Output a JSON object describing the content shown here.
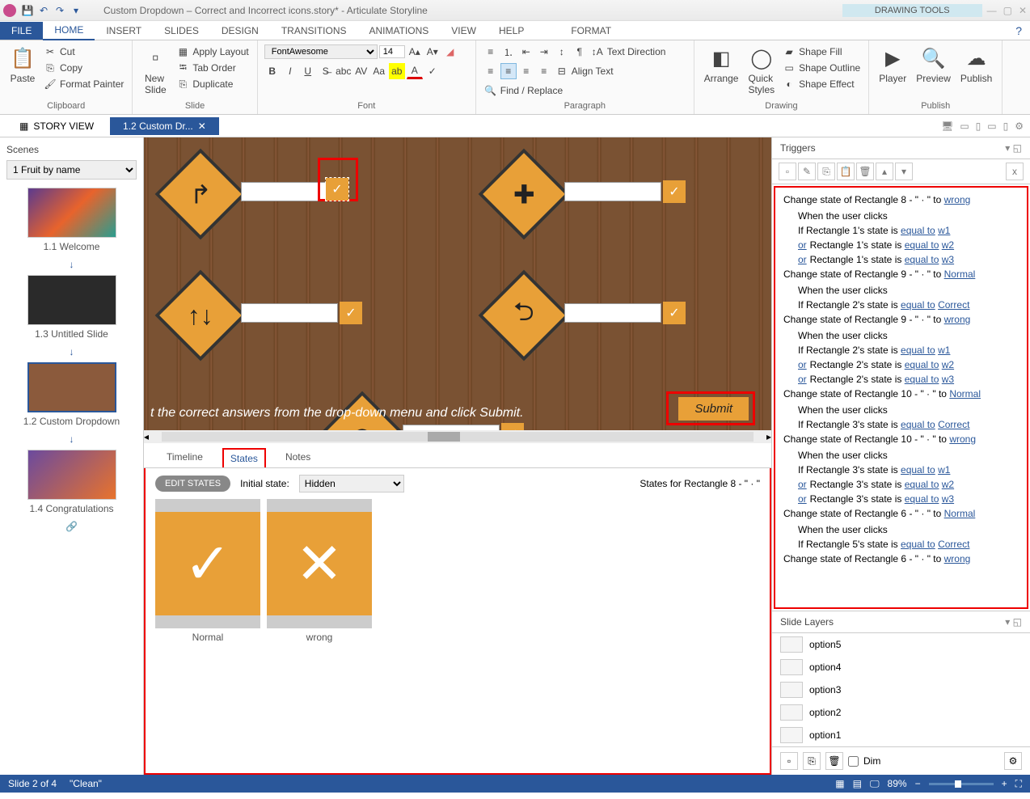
{
  "title": "Custom Dropdown – Correct and Incorrect icons.story* - Articulate Storyline",
  "contextTab": "DRAWING TOOLS",
  "tabs": [
    "FILE",
    "HOME",
    "INSERT",
    "SLIDES",
    "DESIGN",
    "TRANSITIONS",
    "ANIMATIONS",
    "VIEW",
    "HELP",
    "FORMAT"
  ],
  "ribbon": {
    "clipboard": {
      "paste": "Paste",
      "cut": "Cut",
      "copy": "Copy",
      "fmt": "Format Painter",
      "label": "Clipboard"
    },
    "slide": {
      "new": "New\nSlide",
      "layout": "Apply Layout",
      "tab": "Tab Order",
      "dup": "Duplicate",
      "label": "Slide"
    },
    "font": {
      "name": "FontAwesome",
      "size": "14",
      "label": "Font"
    },
    "paragraph": {
      "label": "Paragraph",
      "textdir": "Text Direction",
      "align": "Align Text",
      "find": "Find / Replace"
    },
    "arrange": "Arrange",
    "quick": "Quick\nStyles",
    "drawing": {
      "fill": "Shape Fill",
      "outline": "Shape Outline",
      "effect": "Shape Effect",
      "label": "Drawing"
    },
    "publish": {
      "player": "Player",
      "preview": "Preview",
      "publish": "Publish",
      "label": "Publish"
    }
  },
  "docTabs": {
    "story": "STORY VIEW",
    "active": "1.2 Custom Dr..."
  },
  "scenes": {
    "title": "Scenes",
    "dropdown": "1 Fruit by name",
    "items": [
      "1.1 Welcome",
      "1.3 Untitled Slide",
      "1.2 Custom Dropdown",
      "1.4 Congratulations"
    ]
  },
  "canvas": {
    "instruction": "t the correct answers from the drop-down menu and click Submit.",
    "submit": "Submit"
  },
  "bottomTabs": [
    "Timeline",
    "States",
    "Notes"
  ],
  "states": {
    "edit": "EDIT STATES",
    "initialLabel": "Initial state:",
    "initial": "Hidden",
    "for": "States for Rectangle 8 - \" · \"",
    "items": [
      "Normal",
      "wrong"
    ]
  },
  "triggers": {
    "title": "Triggers",
    "list": [
      {
        "t": "Change state of Rectangle 8 - \" · \" to ",
        "link": "wrong",
        "when": "When the user clicks",
        "conds": [
          {
            "pre": "If Rectangle 1's state is ",
            "l1": "equal to",
            "l2": "w1"
          },
          {
            "or": true,
            "pre": "Rectangle 1's state is ",
            "l1": "equal to",
            "l2": "w2"
          },
          {
            "or": true,
            "pre": "Rectangle 1's state is ",
            "l1": "equal to",
            "l2": "w3"
          }
        ]
      },
      {
        "t": "Change state of Rectangle 9 - \" · \" to ",
        "link": "Normal",
        "when": "When the user clicks",
        "conds": [
          {
            "pre": "If Rectangle 2's state is ",
            "l1": "equal to",
            "l2": "Correct"
          }
        ]
      },
      {
        "t": "Change state of Rectangle 9 - \" · \" to ",
        "link": "wrong",
        "when": "When the user clicks",
        "conds": [
          {
            "pre": "If Rectangle 2's state is ",
            "l1": "equal to",
            "l2": "w1"
          },
          {
            "or": true,
            "pre": "Rectangle 2's state is ",
            "l1": "equal to",
            "l2": "w2"
          },
          {
            "or": true,
            "pre": "Rectangle 2's state is ",
            "l1": "equal to",
            "l2": "w3"
          }
        ]
      },
      {
        "t": "Change state of Rectangle 10 - \" · \" to ",
        "link": "Normal",
        "when": "When the user clicks",
        "conds": [
          {
            "pre": "If Rectangle 3's state is ",
            "l1": "equal to",
            "l2": "Correct"
          }
        ]
      },
      {
        "t": "Change state of Rectangle 10 - \" · \" to ",
        "link": "wrong",
        "when": "When the user clicks",
        "conds": [
          {
            "pre": "If Rectangle 3's state is ",
            "l1": "equal to",
            "l2": "w1"
          },
          {
            "or": true,
            "pre": "Rectangle 3's state is ",
            "l1": "equal to",
            "l2": "w2"
          },
          {
            "or": true,
            "pre": "Rectangle 3's state is ",
            "l1": "equal to",
            "l2": "w3"
          }
        ]
      },
      {
        "t": "Change state of Rectangle 6 - \" · \" to ",
        "link": "Normal",
        "when": "When the user clicks",
        "conds": [
          {
            "pre": "If Rectangle 5's state is ",
            "l1": "equal to",
            "l2": "Correct"
          }
        ]
      },
      {
        "t": "Change state of Rectangle 6 - \" · \" to ",
        "link": "wrong"
      }
    ]
  },
  "layers": {
    "title": "Slide Layers",
    "items": [
      "option5",
      "option4",
      "option3",
      "option2",
      "option1"
    ],
    "dim": "Dim"
  },
  "status": {
    "slide": "Slide 2 of 4",
    "theme": "\"Clean\"",
    "zoom": "89%"
  }
}
